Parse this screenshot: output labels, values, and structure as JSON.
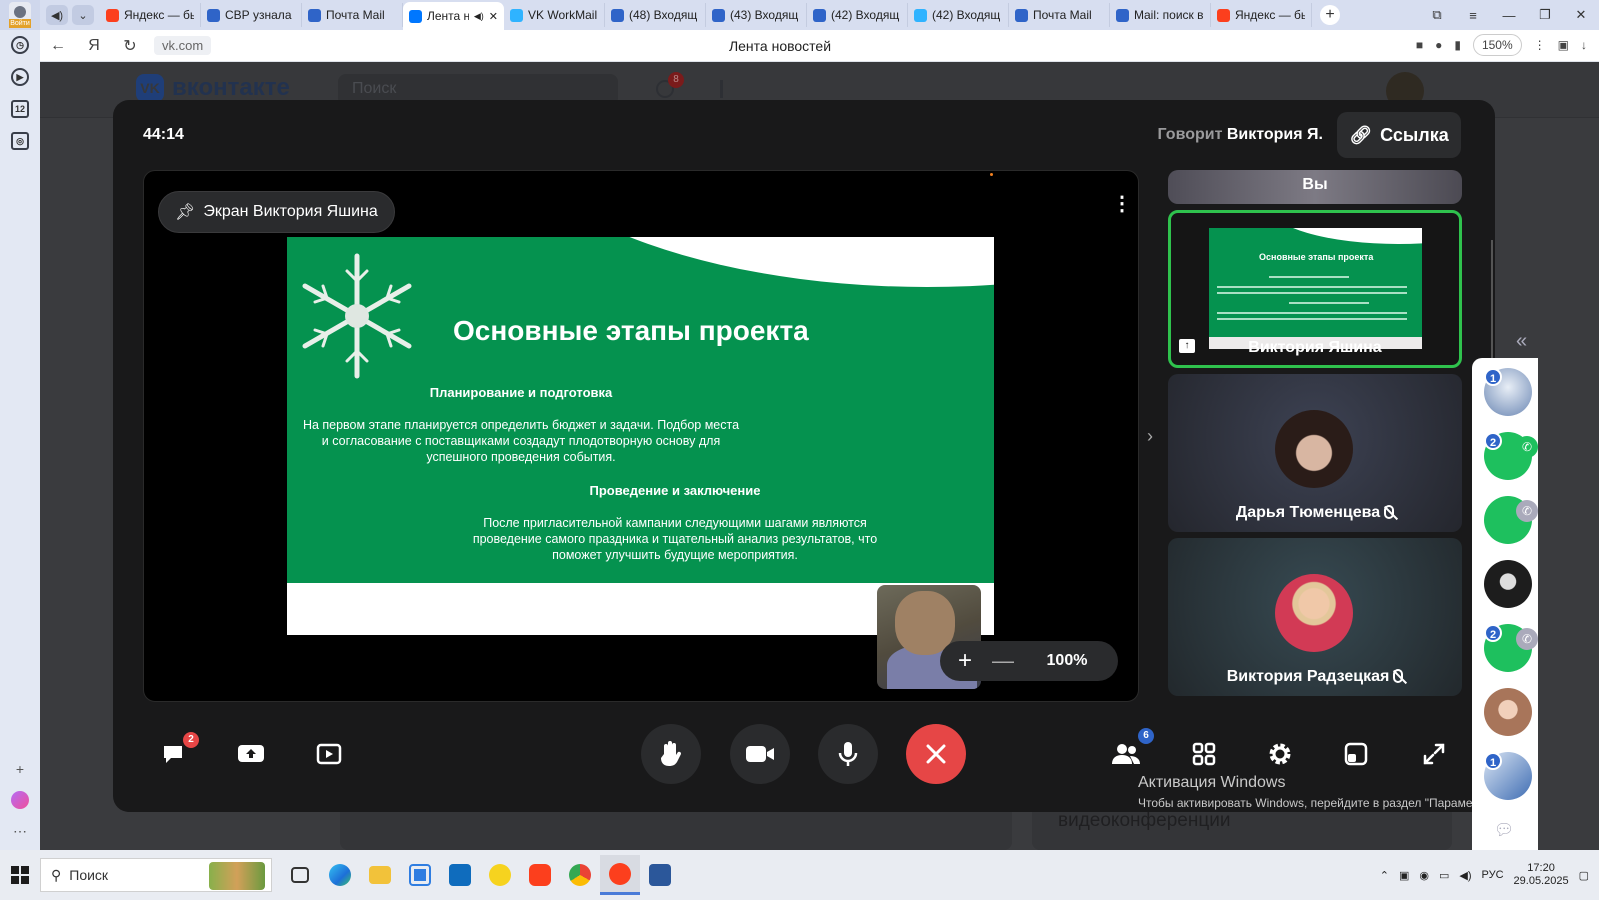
{
  "browser": {
    "login_label": "Войти",
    "tabs": [
      {
        "title": "Яндекс — бы",
        "icon": "yandex-icon",
        "color": "#fc3f1d"
      },
      {
        "title": "СВР узнала с",
        "icon": "mail-at-icon",
        "color": "#2f64c8"
      },
      {
        "title": "Почта Mail",
        "icon": "mail-icon",
        "color": "#2f64c8"
      },
      {
        "title": "Лента н",
        "icon": "vk-icon",
        "color": "#0077ff",
        "active": true
      },
      {
        "title": "VK WorkMail",
        "icon": "vk-workmail-icon",
        "color": "#2fb3ff"
      },
      {
        "title": "(48) Входящ",
        "icon": "mail-icon",
        "color": "#2f64c8"
      },
      {
        "title": "(43) Входящ",
        "icon": "mail-icon",
        "color": "#2f64c8"
      },
      {
        "title": "(42) Входящ",
        "icon": "mail-icon",
        "color": "#2f64c8"
      },
      {
        "title": "(42) Входящ",
        "icon": "vk-workmail-icon",
        "color": "#2fb3ff"
      },
      {
        "title": "Почта Mail",
        "icon": "mail-icon",
        "color": "#2f64c8"
      },
      {
        "title": "Mail: поиск в",
        "icon": "mail-at-icon",
        "color": "#2f64c8"
      },
      {
        "title": "Яндекс — бы",
        "icon": "yandex-icon",
        "color": "#fc3f1d"
      }
    ],
    "url": "vk.com",
    "page_title": "Лента новостей",
    "zoom": "150%"
  },
  "sidebar": {
    "badge_number": "12"
  },
  "vk": {
    "logo": "вконтакте",
    "search_placeholder": "Поиск",
    "notifications": "8",
    "side_card_title": "видеоконференции"
  },
  "call": {
    "timer": "44:14",
    "speaking_prefix": "Говорит",
    "speaking_name": "Виктория Я.",
    "link_label": "Ссылка",
    "pinned_label": "Экран Виктория Яшина",
    "zoom_label": "100%",
    "slide": {
      "title": "Основные этапы проекта",
      "heading1": "Планирование и подготовка",
      "para1": "На первом этапе планируется определить бюджет и задачи. Подбор места и согласование с поставщиками создадут плодотворную основу для успешного проведения события.",
      "heading2": "Проведение и заключение",
      "para2": "После пригласительной кампании следующими шагами являются проведение самого праздника и тщательный анализ результатов, что поможет улучшить будущие мероприятия."
    },
    "participants": [
      {
        "name": "Вы"
      },
      {
        "name": "Виктория Яшина",
        "active_speaker": true
      },
      {
        "name": "Дарья Тюменцева",
        "muted": true
      },
      {
        "name": "Виктория Радзецкая",
        "muted": true
      }
    ],
    "toolbar": {
      "chat_badge": "2",
      "participants_count": "6"
    }
  },
  "windows_activation": {
    "title": "Активация Windows",
    "subtitle": "Чтобы активировать Windows, перейдите в раздел \"Параметры\"."
  },
  "chats": [
    {
      "count": "1",
      "color": "#8aa6c9"
    },
    {
      "count": "2",
      "color": "#1ec05e"
    },
    {
      "count": "",
      "color": "#1ec05e"
    },
    {
      "count": "",
      "color": "#2b2b2b"
    },
    {
      "count": "2",
      "color": "#1ec05e"
    },
    {
      "count": "",
      "color": "#c99777"
    },
    {
      "count": "1",
      "color": "#5a8ad0"
    }
  ],
  "taskbar": {
    "search_label": "Поиск",
    "language": "РУС",
    "time": "17:20",
    "date": "29.05.2025"
  }
}
